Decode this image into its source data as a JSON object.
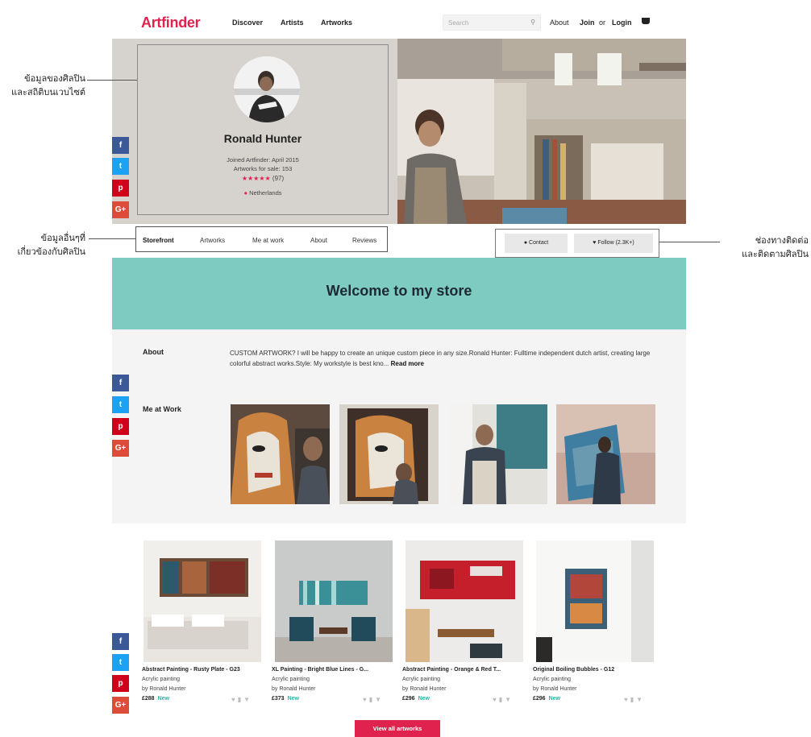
{
  "header": {
    "logo": "Artfinder",
    "nav": [
      "Discover",
      "Artists",
      "Artworks"
    ],
    "search_placeholder": "Search",
    "about": "About",
    "join": "Join",
    "or": "or",
    "login": "Login"
  },
  "profile": {
    "name": "Ronald Hunter",
    "joined": "Joined Artfinder: April 2015",
    "artworks_for_sale": "Artworks for sale: 153",
    "stars": "★★★★★",
    "review_count": "(97)",
    "location": "Netherlands"
  },
  "tabs": [
    "Storefront",
    "Artworks",
    "Me at work",
    "About",
    "Reviews"
  ],
  "actions": {
    "contact": "Contact",
    "follow": "Follow (2.3K+)"
  },
  "welcome": {
    "title": "Welcome to my store"
  },
  "about": {
    "label": "About",
    "text": "CUSTOM ARTWORK? I will be happy to create an unique custom piece in any size.Ronald Hunter: Fulltime independent dutch artist, creating large colorful abstract works.Style: My workstyle is best kno...",
    "read_more": "Read more"
  },
  "me_at_work": {
    "label": "Me at Work"
  },
  "artworks": [
    {
      "title": "Abstract Painting - Rusty Plate - G23",
      "medium": "Acrylic painting",
      "by": "by Ronald Hunter",
      "price": "£288",
      "badge": "New"
    },
    {
      "title": "XL Painting - Bright Blue Lines - G...",
      "medium": "Acrylic painting",
      "by": "by Ronald Hunter",
      "price": "£373",
      "badge": "New"
    },
    {
      "title": "Abstract Painting - Orange & Red T...",
      "medium": "Acrylic painting",
      "by": "by Ronald Hunter",
      "price": "£296",
      "badge": "New"
    },
    {
      "title": "Original Boiling Bubbles - G12",
      "medium": "Acrylic painting",
      "by": "by Ronald Hunter",
      "price": "£296",
      "badge": "New"
    }
  ],
  "view_all": "View all artworks",
  "annotations": {
    "artist_info": [
      "ข้อมูลของศิลปิน",
      "และสถิติบนเวบไซต์"
    ],
    "other_info": [
      "ข้อมูลอื่นๆที่",
      "เกี่ยวข้องกับศิลปิน"
    ],
    "contact_follow": [
      "ช่องทางติดต่อ",
      "และติดตามศิลปิน"
    ]
  },
  "social": [
    "f",
    "t",
    "p",
    "G+"
  ],
  "colors": {
    "brand": "#e0224e",
    "welcome_bg": "#7ecbc2",
    "accent_new": "#2bb3a3"
  }
}
